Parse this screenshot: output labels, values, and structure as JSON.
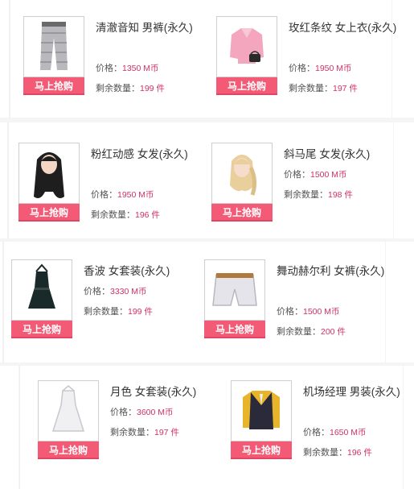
{
  "labels": {
    "price": "价格：",
    "stock": "剩余数量：",
    "buy": "马上抢购"
  },
  "colors": {
    "buy_button": "#f25a76",
    "value_text": "#d0306a"
  },
  "items": [
    {
      "name": "清澈音知 男裤(永久)",
      "price": "1350 M币",
      "stock": "199 件",
      "icon": "grey-pants-icon"
    },
    {
      "name": "玫红条纹 女上衣(永久)",
      "price": "1950 M币",
      "stock": "197 件",
      "icon": "pink-jacket-icon"
    },
    {
      "name": "粉红动感 女发(永久)",
      "price": "1950 M币",
      "stock": "196 件",
      "icon": "long-black-hair-icon"
    },
    {
      "name": "斜马尾 女发(永久)",
      "price": "1500 M币",
      "stock": "198 件",
      "icon": "blonde-ponytail-icon"
    },
    {
      "name": "香波 女套装(永久)",
      "price": "3330 M币",
      "stock": "199 件",
      "icon": "black-dress-icon"
    },
    {
      "name": "舞动赫尔利 女裤(永久)",
      "price": "1500 M币",
      "stock": "200 件",
      "icon": "white-shorts-icon"
    },
    {
      "name": "月色 女套装(永久)",
      "price": "3600 M币",
      "stock": "197 件",
      "icon": "white-dress-icon"
    },
    {
      "name": "机场经理 男装(永久)",
      "price": "1650 M币",
      "stock": "196 件",
      "icon": "vest-suit-icon"
    }
  ]
}
